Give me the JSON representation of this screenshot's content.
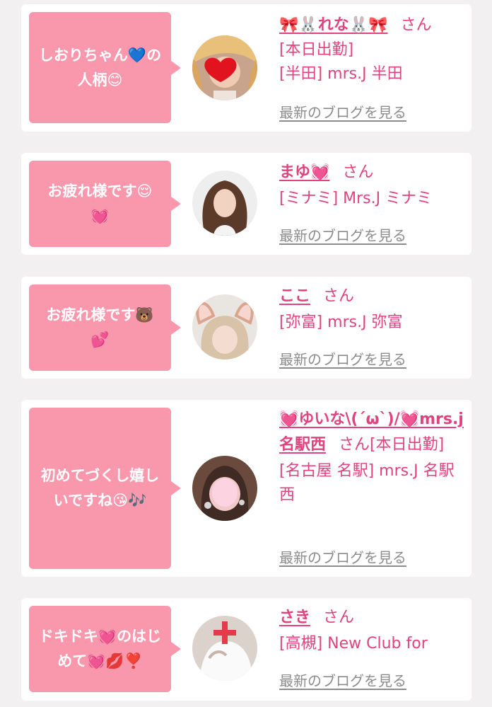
{
  "entries": [
    {
      "bubble": "しおりちゃん💙の\n人柄😊",
      "name": "🎀🐰れな🐰🎀",
      "suffix": "さん",
      "status": "[本日出勤]",
      "shop": "[半田] mrs.J 半田",
      "blog_link": "最新のブログを見る",
      "avatar": "avatar-photo-heart"
    },
    {
      "bubble": "お疲れ様です😌\n💓",
      "name": "まゆ💓",
      "suffix": "さん",
      "status": "",
      "shop": "[ミナミ] Mrs.J ミナミ",
      "blog_link": "最新のブログを見る",
      "avatar": "avatar-photo-longhair"
    },
    {
      "bubble": "お疲れ様です🐻\n💕",
      "name": "ここ",
      "suffix": "さん",
      "status": "",
      "shop": "[弥富] mrs.J 弥富",
      "blog_link": "最新のブログを見る",
      "avatar": "avatar-photo-bunnyears"
    },
    {
      "bubble": "初めてづくし嬉し\nいですね😘🎶",
      "name": "💓ゆいな\\(´ω`)/💓mrs.j名駅西",
      "suffix": "さん",
      "status": "[本日出勤]",
      "shop": "[名古屋 名駅] mrs.J 名駅西",
      "blog_link": "最新のブログを見る",
      "avatar": "avatar-photo-blurred"
    },
    {
      "bubble": "ドキドキ💓のはじ\nめて💓💋❣️",
      "name": "さき",
      "suffix": "さん",
      "status": "",
      "shop": "[高槻] New Club for",
      "blog_link": "最新のブログを見る",
      "avatar": "avatar-photo-nurse"
    }
  ]
}
